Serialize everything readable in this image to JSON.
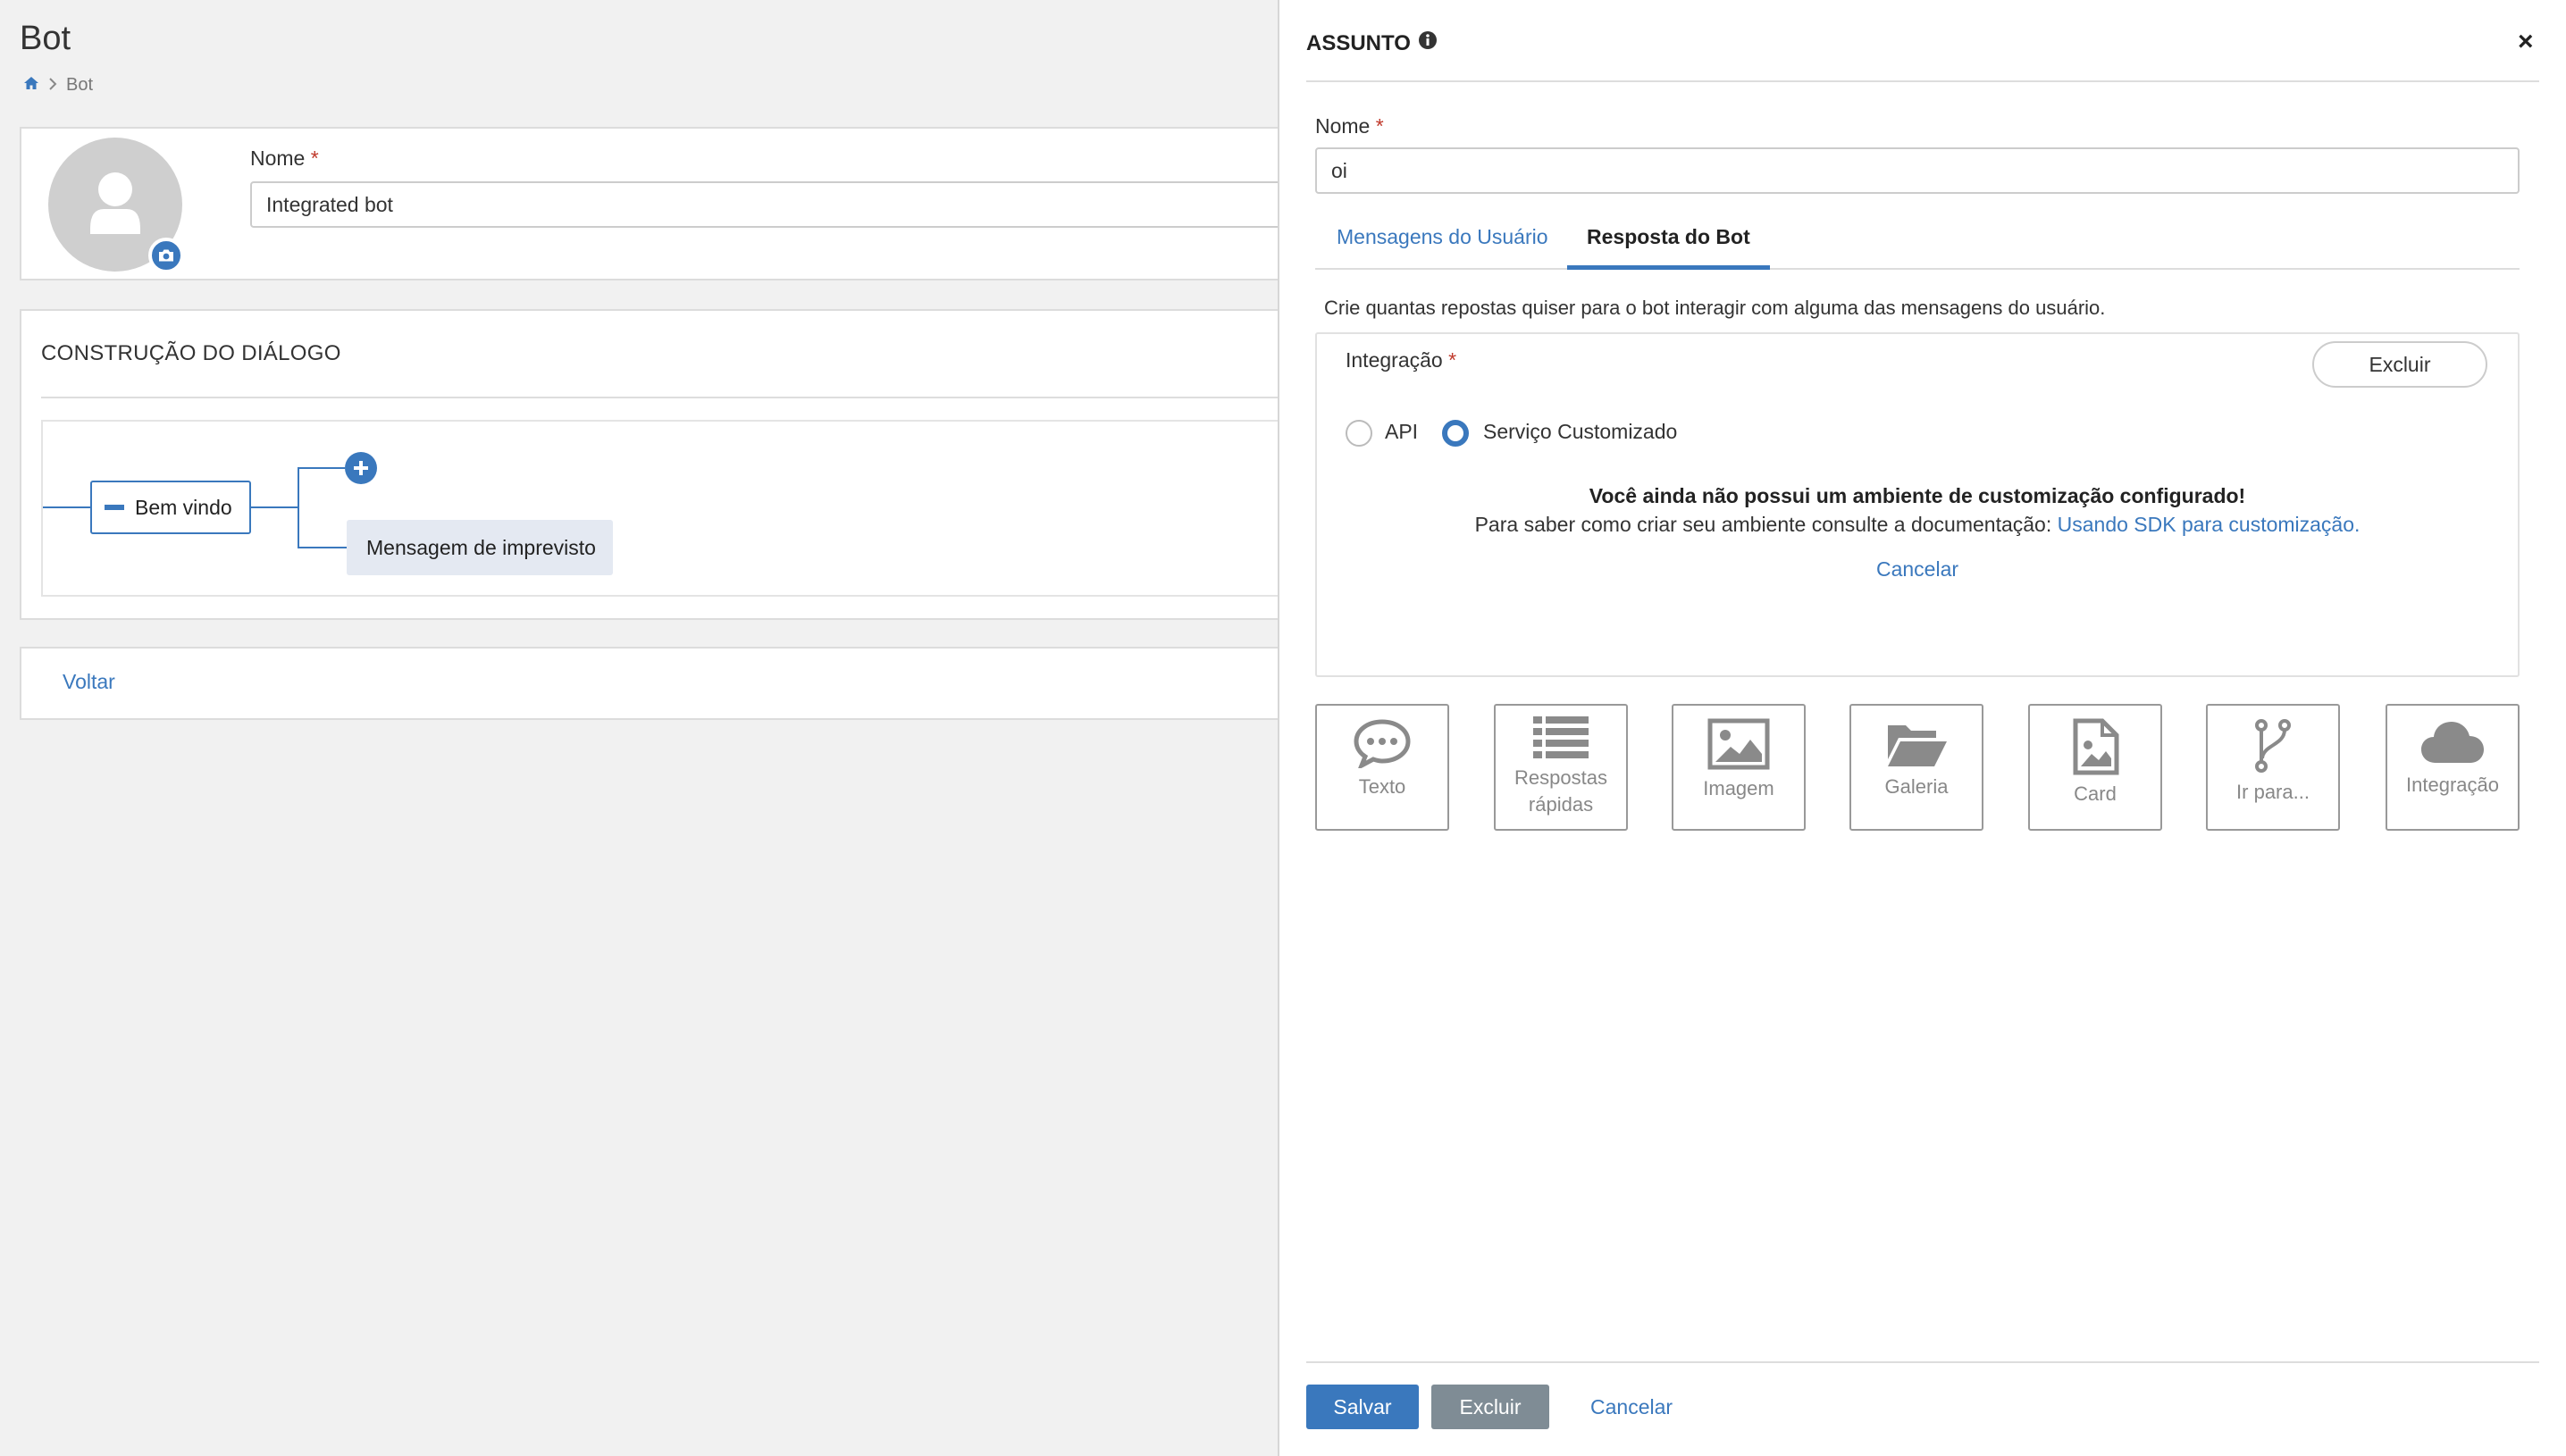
{
  "page": {
    "title": "Bot",
    "breadcrumb": {
      "home_icon": "home-icon",
      "separator_icon": "chevron-right-icon",
      "current": "Bot"
    }
  },
  "profile": {
    "name_label": "Nome",
    "required_mark": "*",
    "name_value": "Integrated bot",
    "avatar_icon": "user-icon",
    "camera_icon": "camera-icon"
  },
  "dialog": {
    "title": "CONSTRUÇÃO DO DIÁLOGO",
    "nodes": {
      "welcome": "Bem vindo",
      "fallback": "Mensagem de imprevisto"
    },
    "add_icon": "plus-icon",
    "collapse_icon": "minus-icon"
  },
  "back_link": "Voltar",
  "drawer": {
    "title": "ASSUNTO",
    "info_icon": "info-icon",
    "close_label": "×",
    "name_label": "Nome",
    "required_mark": "*",
    "name_value": "oi",
    "tabs": [
      {
        "label": "Mensagens do Usuário",
        "active": false
      },
      {
        "label": "Resposta do Bot",
        "active": true
      }
    ],
    "description": "Crie quantas repostas quiser para o bot interagir com alguma das mensagens do usuário.",
    "integration": {
      "label": "Integração",
      "required_mark": "*",
      "delete_label": "Excluir",
      "options": [
        {
          "label": "API",
          "checked": false
        },
        {
          "label": "Serviço Customizado",
          "checked": true
        }
      ],
      "warning_title": "Você ainda não possui um ambiente de customização configurado!",
      "warning_text": "Para saber como criar seu ambiente consulte a documentação:",
      "warning_link": "Usando SDK para customização.",
      "cancel_label": "Cancelar"
    },
    "response_types": [
      {
        "label": "Texto",
        "icon": "speech-bubble-icon"
      },
      {
        "label": "Respostas rápidas",
        "icon": "list-icon"
      },
      {
        "label": "Imagem",
        "icon": "image-icon"
      },
      {
        "label": "Galeria",
        "icon": "folder-open-icon"
      },
      {
        "label": "Card",
        "icon": "file-image-icon"
      },
      {
        "label": "Ir para...",
        "icon": "branch-icon"
      },
      {
        "label": "Integração",
        "icon": "cloud-icon"
      }
    ],
    "footer": {
      "save_label": "Salvar",
      "delete_label": "Excluir",
      "cancel_label": "Cancelar"
    }
  },
  "colors": {
    "accent": "#3a78bd",
    "background": "#f1f1f1",
    "required": "#c0392b",
    "secondary_button": "#7f8c95"
  }
}
